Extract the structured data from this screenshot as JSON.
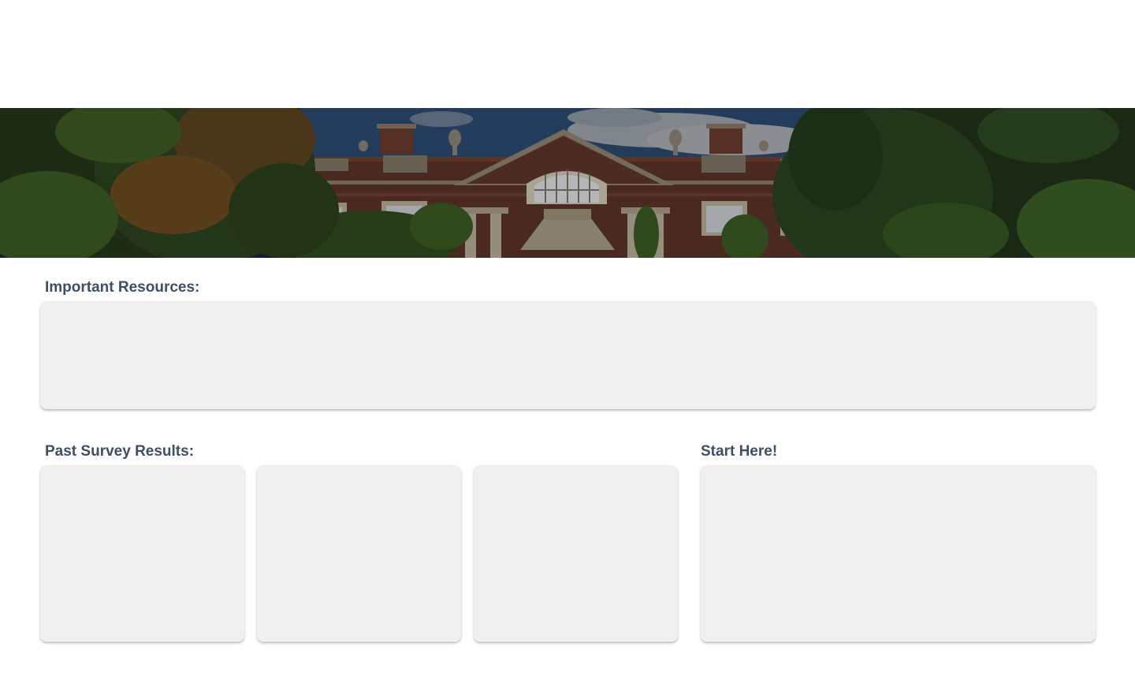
{
  "header": {
    "banner_image": "campus-building-banner"
  },
  "sections": {
    "important_resources": {
      "label": "Important Resources:"
    },
    "past_survey_results": {
      "label": "Past Survey Results:",
      "cards": 3
    },
    "start_here": {
      "label": "Start Here!"
    }
  },
  "colors": {
    "label_text": "#3c4f69",
    "card_background": "#f0f0f0",
    "page_background": "#ffffff"
  }
}
